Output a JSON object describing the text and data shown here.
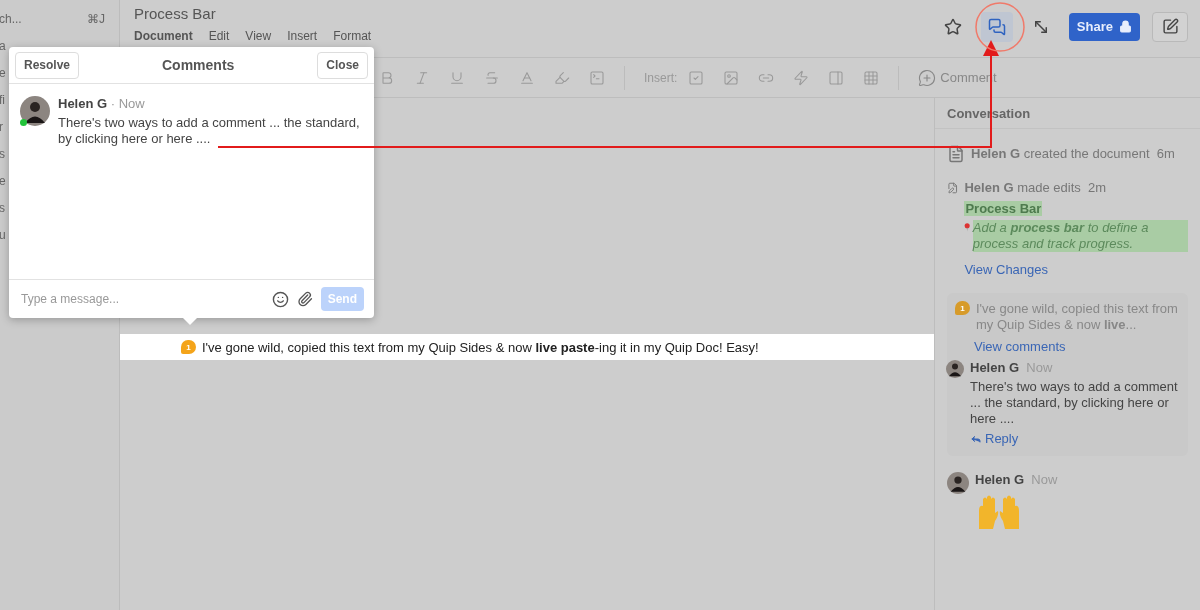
{
  "sidebar": {
    "search": {
      "placeholder": "ch...",
      "shortcut": "⌘J"
    },
    "items": [
      "a",
      "e",
      "fi",
      "r",
      "s",
      "e",
      "s",
      "u"
    ]
  },
  "document": {
    "title": "Process Bar",
    "menu": [
      {
        "label": "Document",
        "selected": true
      },
      {
        "label": "Edit",
        "selected": false
      },
      {
        "label": "View",
        "selected": false
      },
      {
        "label": "Insert",
        "selected": false
      },
      {
        "label": "Format",
        "selected": false
      }
    ]
  },
  "top_actions": {
    "conversation_open": true,
    "share": "Share"
  },
  "toolbar": {
    "insert_label": "Insert:",
    "comment": "Comment"
  },
  "highlighted_line": {
    "badge": "1",
    "text": "I've gone wild, copied this text from my Quip Sides & now **live paste**-ing it in my Quip Doc! Easy!"
  },
  "conversation": {
    "title": "Conversation",
    "events": [
      {
        "kind": "created",
        "author": "Helen G",
        "action": "created the document",
        "time": "6m"
      },
      {
        "kind": "edit",
        "author": "Helen G",
        "action": "made edits",
        "time": "2m",
        "heading": "Process Bar",
        "snippet": "Add a **process bar** to define a process and track progress.",
        "link": "View Changes"
      },
      {
        "kind": "thread",
        "badge": "1",
        "quote": "I've gone wild, copied this text from my Quip Sides & now **live**...",
        "link": "View comments",
        "author": "Helen G",
        "time": "Now",
        "text": "There's two ways to add a comment ... the standard, by clicking here or here ....",
        "reply": "Reply"
      },
      {
        "kind": "message",
        "author": "Helen G",
        "time": "Now"
      }
    ]
  },
  "popup": {
    "resolve": "Resolve",
    "title": "Comments",
    "close": "Close",
    "comment": {
      "author": "Helen G",
      "time": "· Now",
      "online": true,
      "text": "There's two ways to add a comment ... the standard, by clicking here or here ...."
    },
    "input": {
      "placeholder": "Type a message..."
    },
    "send": {
      "label": "Send",
      "disabled": true
    }
  }
}
